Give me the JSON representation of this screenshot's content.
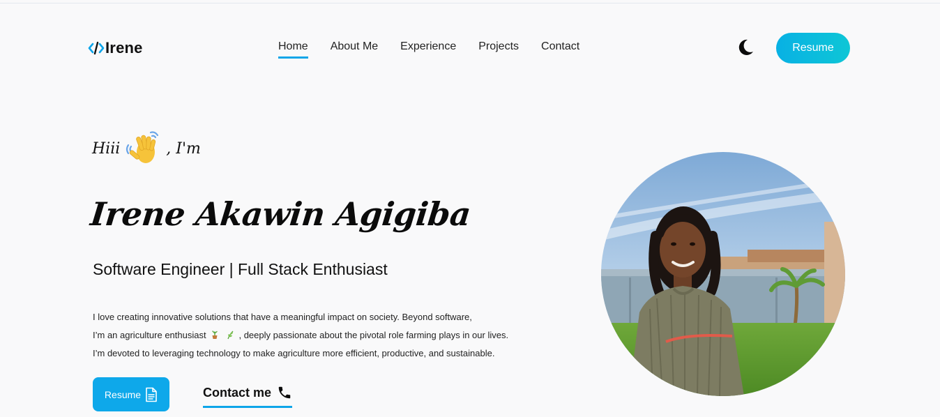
{
  "brand": {
    "logo_icon": "code-brackets-icon",
    "name": "Irene",
    "accent": "#0ea5e9"
  },
  "nav": {
    "items": [
      {
        "label": "Home",
        "active": true
      },
      {
        "label": "About Me",
        "active": false
      },
      {
        "label": "Experience",
        "active": false
      },
      {
        "label": "Projects",
        "active": false
      },
      {
        "label": "Contact",
        "active": false
      }
    ],
    "theme_toggle_icon": "moon-icon",
    "resume_label": "Resume"
  },
  "hero": {
    "greeting_before": "Hiii",
    "greeting_icon": "waving-hand-icon",
    "greeting_after": ", I'm",
    "name": "Irene Akawin Agigiba",
    "role": "Software Engineer | Full Stack Enthusiast",
    "bio": {
      "line1": "I love creating innovative solutions that have a meaningful impact on society. Beyond software,",
      "line2_before": "I’m an agriculture enthusiast",
      "line2_icons": [
        "potted-plant-icon",
        "herb-icon"
      ],
      "line2_after": ", deeply passionate about the pivotal role farming plays in our lives.",
      "line3": "I’m devoted to leveraging technology to make agriculture more efficient, productive, and sustainable."
    },
    "resume_button": {
      "label": "Resume",
      "icon": "document-icon"
    },
    "contact_link": {
      "label": "Contact me",
      "icon": "phone-icon"
    },
    "photo_icon": "profile-photo"
  }
}
